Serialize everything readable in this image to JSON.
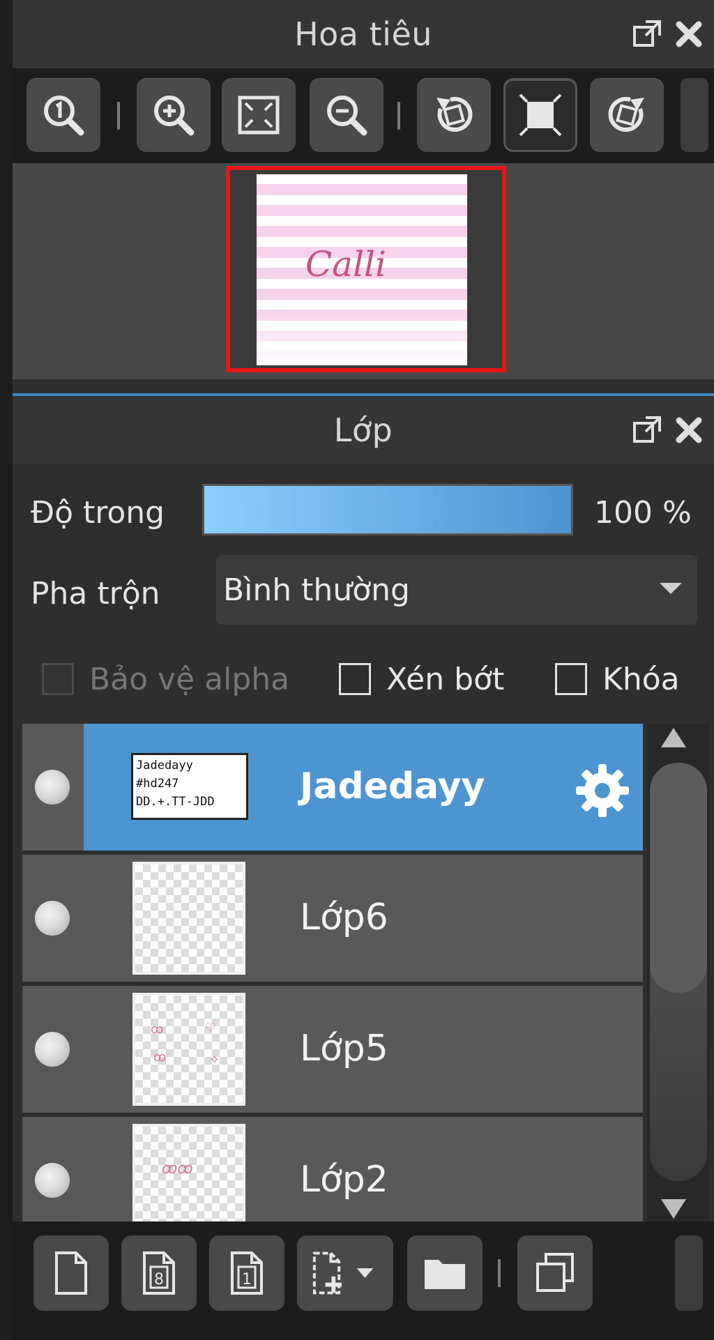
{
  "navigator": {
    "title": "Hoa tiêu",
    "toolbar_icons": [
      "zoom-actual-size-icon",
      "zoom-in-icon",
      "fit-screen-icon",
      "zoom-out-icon",
      "rotate-left-icon",
      "reset-view-icon",
      "rotate-right-icon"
    ],
    "preview_text": "Calli"
  },
  "layers_panel": {
    "title": "Lớp",
    "opacity": {
      "label": "Độ trong",
      "value": "100 %",
      "fraction": 1.0
    },
    "blend": {
      "label": "Pha trộn",
      "value": "Bình thường"
    },
    "checkboxes": [
      {
        "label": "Bảo vệ alpha",
        "checked": false,
        "disabled": true
      },
      {
        "label": "Xén bớt",
        "checked": false,
        "disabled": false
      },
      {
        "label": "Khóa",
        "checked": false,
        "disabled": false
      }
    ],
    "layers": [
      {
        "name": "Jadedayy",
        "selected": true,
        "thumb_text": "Jadedayy\n#hd247\nDD.+.TT-JDD"
      },
      {
        "name": "Lớp6",
        "selected": false
      },
      {
        "name": "Lớp5",
        "selected": false
      },
      {
        "name": "Lớp2",
        "selected": false
      }
    ],
    "bottom_toolbar_icons": [
      "new-layer-icon",
      "new-8bit-layer-icon",
      "new-1bit-layer-icon",
      "add-special-layer-icon",
      "new-folder-icon",
      "duplicate-layer-icon"
    ]
  },
  "colors": {
    "accent": "#4d95d0",
    "preview_border": "#e81616"
  }
}
